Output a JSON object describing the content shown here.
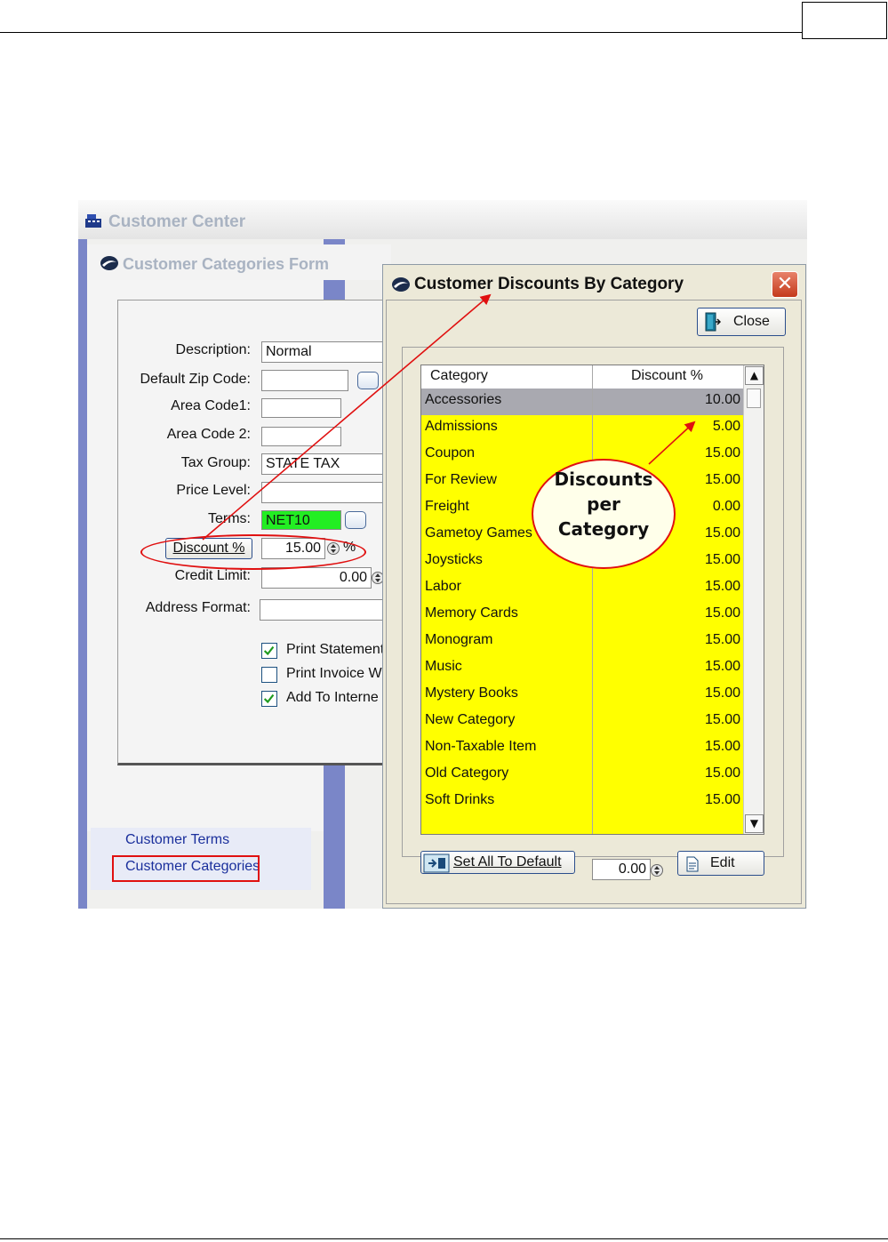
{
  "customer_center": {
    "title": "Customer Center"
  },
  "categories_form": {
    "title": "Customer Categories Form",
    "fields": {
      "description": {
        "label": "Description:",
        "value": "Normal"
      },
      "default_zip": {
        "label": "Default Zip Code:",
        "value": ""
      },
      "area_code1": {
        "label": "Area Code1:",
        "value": ""
      },
      "area_code2": {
        "label": "Area Code 2:",
        "value": ""
      },
      "tax_group": {
        "label": "Tax Group:",
        "value": "STATE TAX"
      },
      "price_level": {
        "label": "Price Level:",
        "value": ""
      },
      "terms": {
        "label": "Terms:",
        "value": "NET10"
      },
      "discount": {
        "button_label": "Discount %",
        "value": "15.00",
        "unit": "%"
      },
      "credit_limit": {
        "label": "Credit Limit:",
        "value": "0.00"
      },
      "address_format": {
        "label": "Address Format:",
        "value": ""
      }
    },
    "checkboxes": [
      {
        "label": "Print Statement",
        "checked": true
      },
      {
        "label": "Print Invoice W",
        "checked": false
      },
      {
        "label": "Add To Interne",
        "checked": true
      }
    ]
  },
  "nav": {
    "items": [
      "Customer Terms",
      "Customer Categories"
    ]
  },
  "dialog": {
    "title": "Customer Discounts By Category",
    "close_label": "Close",
    "columns": [
      "Category",
      "Discount %"
    ],
    "rows": [
      {
        "category": "Accessories",
        "discount": "10.00"
      },
      {
        "category": "Admissions",
        "discount": "5.00"
      },
      {
        "category": "Coupon",
        "discount": "15.00"
      },
      {
        "category": "For Review",
        "discount": "15.00"
      },
      {
        "category": "Freight",
        "discount": "0.00"
      },
      {
        "category": "Gametoy Games",
        "discount": "15.00"
      },
      {
        "category": "Joysticks",
        "discount": "15.00"
      },
      {
        "category": "Labor",
        "discount": "15.00"
      },
      {
        "category": "Memory Cards",
        "discount": "15.00"
      },
      {
        "category": "Monogram",
        "discount": "15.00"
      },
      {
        "category": "Music",
        "discount": "15.00"
      },
      {
        "category": "Mystery Books",
        "discount": "15.00"
      },
      {
        "category": "New Category",
        "discount": "15.00"
      },
      {
        "category": "Non-Taxable Item",
        "discount": "15.00"
      },
      {
        "category": "Old Category",
        "discount": "15.00"
      },
      {
        "category": "Soft Drinks",
        "discount": "15.00"
      }
    ],
    "set_all_label": "Set All To Default",
    "default_value": "0.00",
    "edit_label": "Edit"
  },
  "callout": {
    "line1": "Discounts",
    "line2": "per",
    "line3": "Category"
  },
  "colors": {
    "grid_bg": "#ffff00",
    "terms_bg": "#22ee22",
    "annotation": "#e01010",
    "nav_text": "#1a2f9c"
  }
}
